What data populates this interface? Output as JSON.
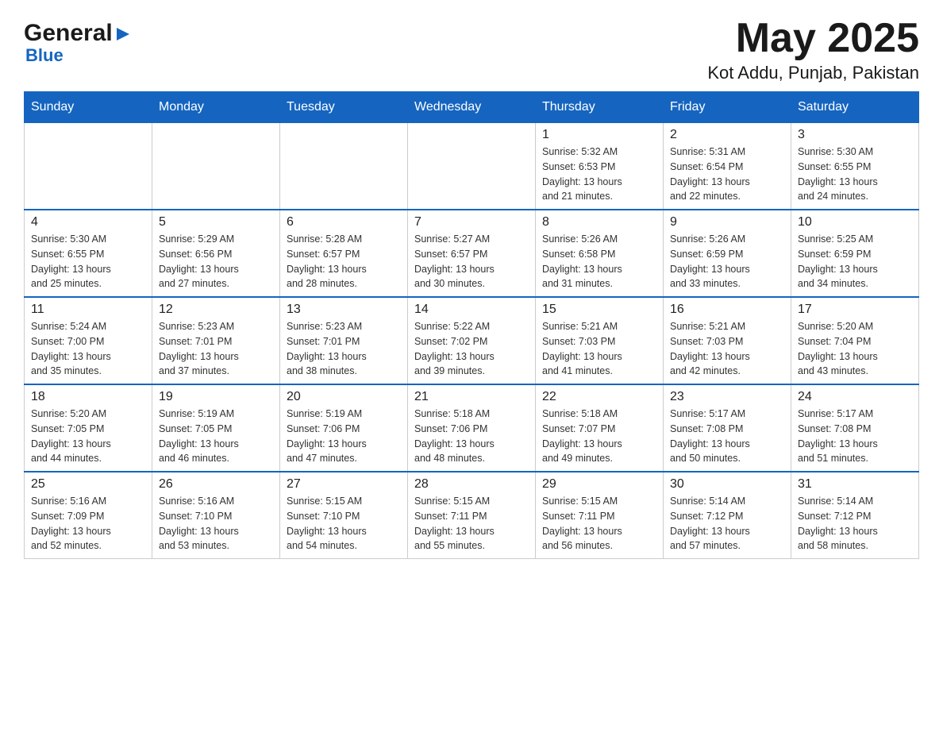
{
  "header": {
    "logo_general": "General",
    "logo_blue": "Blue",
    "month_year": "May 2025",
    "location": "Kot Addu, Punjab, Pakistan"
  },
  "days_of_week": [
    "Sunday",
    "Monday",
    "Tuesday",
    "Wednesday",
    "Thursday",
    "Friday",
    "Saturday"
  ],
  "weeks": [
    {
      "days": [
        {
          "number": "",
          "info": ""
        },
        {
          "number": "",
          "info": ""
        },
        {
          "number": "",
          "info": ""
        },
        {
          "number": "",
          "info": ""
        },
        {
          "number": "1",
          "info": "Sunrise: 5:32 AM\nSunset: 6:53 PM\nDaylight: 13 hours\nand 21 minutes."
        },
        {
          "number": "2",
          "info": "Sunrise: 5:31 AM\nSunset: 6:54 PM\nDaylight: 13 hours\nand 22 minutes."
        },
        {
          "number": "3",
          "info": "Sunrise: 5:30 AM\nSunset: 6:55 PM\nDaylight: 13 hours\nand 24 minutes."
        }
      ]
    },
    {
      "days": [
        {
          "number": "4",
          "info": "Sunrise: 5:30 AM\nSunset: 6:55 PM\nDaylight: 13 hours\nand 25 minutes."
        },
        {
          "number": "5",
          "info": "Sunrise: 5:29 AM\nSunset: 6:56 PM\nDaylight: 13 hours\nand 27 minutes."
        },
        {
          "number": "6",
          "info": "Sunrise: 5:28 AM\nSunset: 6:57 PM\nDaylight: 13 hours\nand 28 minutes."
        },
        {
          "number": "7",
          "info": "Sunrise: 5:27 AM\nSunset: 6:57 PM\nDaylight: 13 hours\nand 30 minutes."
        },
        {
          "number": "8",
          "info": "Sunrise: 5:26 AM\nSunset: 6:58 PM\nDaylight: 13 hours\nand 31 minutes."
        },
        {
          "number": "9",
          "info": "Sunrise: 5:26 AM\nSunset: 6:59 PM\nDaylight: 13 hours\nand 33 minutes."
        },
        {
          "number": "10",
          "info": "Sunrise: 5:25 AM\nSunset: 6:59 PM\nDaylight: 13 hours\nand 34 minutes."
        }
      ]
    },
    {
      "days": [
        {
          "number": "11",
          "info": "Sunrise: 5:24 AM\nSunset: 7:00 PM\nDaylight: 13 hours\nand 35 minutes."
        },
        {
          "number": "12",
          "info": "Sunrise: 5:23 AM\nSunset: 7:01 PM\nDaylight: 13 hours\nand 37 minutes."
        },
        {
          "number": "13",
          "info": "Sunrise: 5:23 AM\nSunset: 7:01 PM\nDaylight: 13 hours\nand 38 minutes."
        },
        {
          "number": "14",
          "info": "Sunrise: 5:22 AM\nSunset: 7:02 PM\nDaylight: 13 hours\nand 39 minutes."
        },
        {
          "number": "15",
          "info": "Sunrise: 5:21 AM\nSunset: 7:03 PM\nDaylight: 13 hours\nand 41 minutes."
        },
        {
          "number": "16",
          "info": "Sunrise: 5:21 AM\nSunset: 7:03 PM\nDaylight: 13 hours\nand 42 minutes."
        },
        {
          "number": "17",
          "info": "Sunrise: 5:20 AM\nSunset: 7:04 PM\nDaylight: 13 hours\nand 43 minutes."
        }
      ]
    },
    {
      "days": [
        {
          "number": "18",
          "info": "Sunrise: 5:20 AM\nSunset: 7:05 PM\nDaylight: 13 hours\nand 44 minutes."
        },
        {
          "number": "19",
          "info": "Sunrise: 5:19 AM\nSunset: 7:05 PM\nDaylight: 13 hours\nand 46 minutes."
        },
        {
          "number": "20",
          "info": "Sunrise: 5:19 AM\nSunset: 7:06 PM\nDaylight: 13 hours\nand 47 minutes."
        },
        {
          "number": "21",
          "info": "Sunrise: 5:18 AM\nSunset: 7:06 PM\nDaylight: 13 hours\nand 48 minutes."
        },
        {
          "number": "22",
          "info": "Sunrise: 5:18 AM\nSunset: 7:07 PM\nDaylight: 13 hours\nand 49 minutes."
        },
        {
          "number": "23",
          "info": "Sunrise: 5:17 AM\nSunset: 7:08 PM\nDaylight: 13 hours\nand 50 minutes."
        },
        {
          "number": "24",
          "info": "Sunrise: 5:17 AM\nSunset: 7:08 PM\nDaylight: 13 hours\nand 51 minutes."
        }
      ]
    },
    {
      "days": [
        {
          "number": "25",
          "info": "Sunrise: 5:16 AM\nSunset: 7:09 PM\nDaylight: 13 hours\nand 52 minutes."
        },
        {
          "number": "26",
          "info": "Sunrise: 5:16 AM\nSunset: 7:10 PM\nDaylight: 13 hours\nand 53 minutes."
        },
        {
          "number": "27",
          "info": "Sunrise: 5:15 AM\nSunset: 7:10 PM\nDaylight: 13 hours\nand 54 minutes."
        },
        {
          "number": "28",
          "info": "Sunrise: 5:15 AM\nSunset: 7:11 PM\nDaylight: 13 hours\nand 55 minutes."
        },
        {
          "number": "29",
          "info": "Sunrise: 5:15 AM\nSunset: 7:11 PM\nDaylight: 13 hours\nand 56 minutes."
        },
        {
          "number": "30",
          "info": "Sunrise: 5:14 AM\nSunset: 7:12 PM\nDaylight: 13 hours\nand 57 minutes."
        },
        {
          "number": "31",
          "info": "Sunrise: 5:14 AM\nSunset: 7:12 PM\nDaylight: 13 hours\nand 58 minutes."
        }
      ]
    }
  ]
}
